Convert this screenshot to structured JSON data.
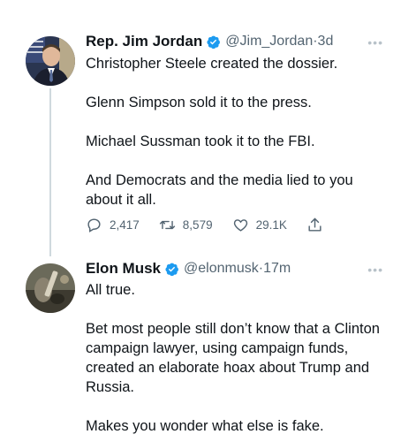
{
  "tweets": [
    {
      "name": "Rep. Jim Jordan",
      "handle": "@Jim_Jordan",
      "time": "3d",
      "paragraphs": [
        "Christopher Steele created the dossier.",
        "Glenn Simpson sold it to the press.",
        "Michael Sussman took it to the FBI.",
        "And Democrats and the media lied to you about it all."
      ],
      "replies": "2,417",
      "retweets": "8,579",
      "likes": "29.1K"
    },
    {
      "name": "Elon Musk",
      "handle": "@elonmusk",
      "time": "17m",
      "paragraphs": [
        "All true.",
        "Bet most people still don’t know that a Clinton campaign lawyer, using campaign funds, created an elaborate hoax about Trump and Russia.",
        "Makes you wonder what else is fake."
      ]
    }
  ],
  "separator": " · ",
  "colors": {
    "verified": "#1d9bf0",
    "secondary": "#536471",
    "thread": "#cfd9de"
  },
  "icons": [
    "verified-icon",
    "more-icon",
    "reply-icon",
    "retweet-icon",
    "like-icon",
    "share-icon"
  ]
}
